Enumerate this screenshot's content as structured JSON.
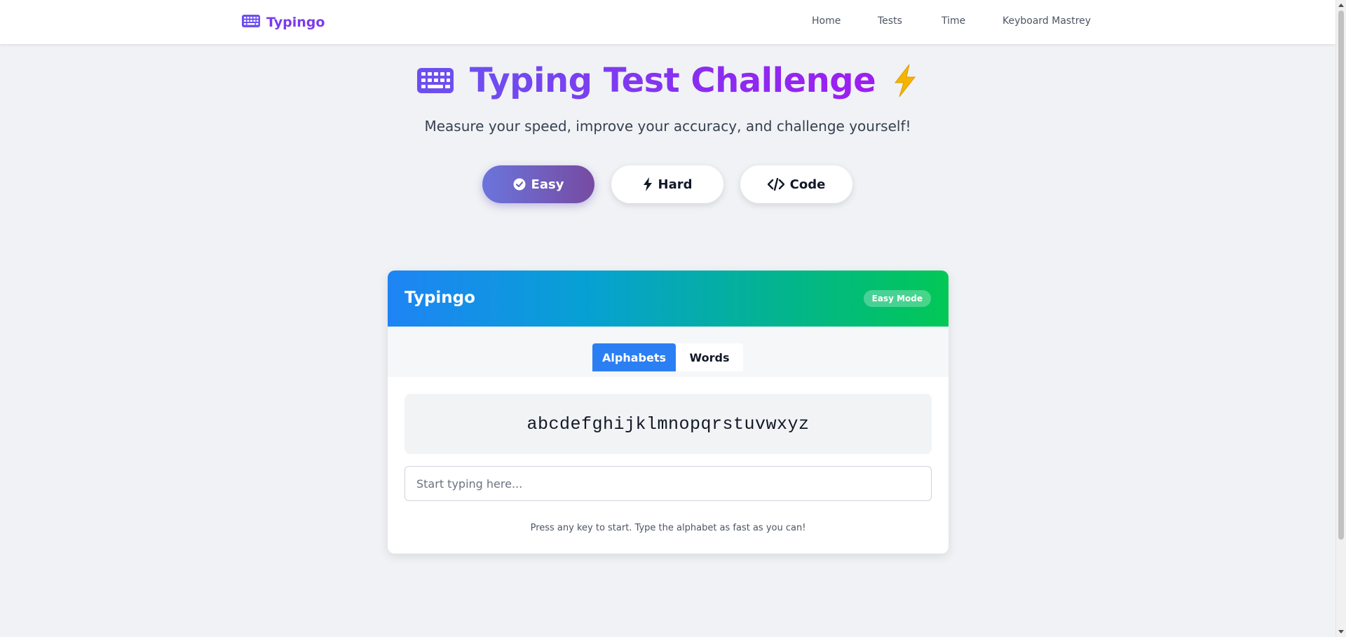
{
  "nav": {
    "brand": "Typingo",
    "links": [
      "Home",
      "Tests",
      "Time",
      "Keyboard Mastrey"
    ]
  },
  "hero": {
    "title": "Typing Test Challenge",
    "subtitle": "Measure your speed, improve your accuracy, and challenge yourself!",
    "icon_left": "keyboard-icon",
    "icon_right": "lightning-bolt-icon"
  },
  "modes": [
    {
      "label": "Easy",
      "icon": "check-circle-icon",
      "active": true
    },
    {
      "label": "Hard",
      "icon": "bolt-icon",
      "active": false
    },
    {
      "label": "Code",
      "icon": "code-icon",
      "active": false
    }
  ],
  "card": {
    "title": "Typingo",
    "badge": "Easy Mode",
    "tabs": [
      {
        "label": "Alphabets",
        "active": true
      },
      {
        "label": "Words",
        "active": false
      }
    ],
    "target_text": "abcdefghijklmnopqrstuvwxyz",
    "input": {
      "value": "",
      "placeholder": "Start typing here..."
    },
    "hint": "Press any key to start. Type the alphabet as fast as you can!"
  },
  "colors": {
    "brand": "#7c3aed",
    "active_tab": "#2b7ff3",
    "easy_gradient_start": "#667eea",
    "easy_gradient_end": "#764ba2",
    "header_gradient_start": "#1e84f5",
    "header_gradient_end": "#02c856",
    "bolt": "#f5b400"
  }
}
